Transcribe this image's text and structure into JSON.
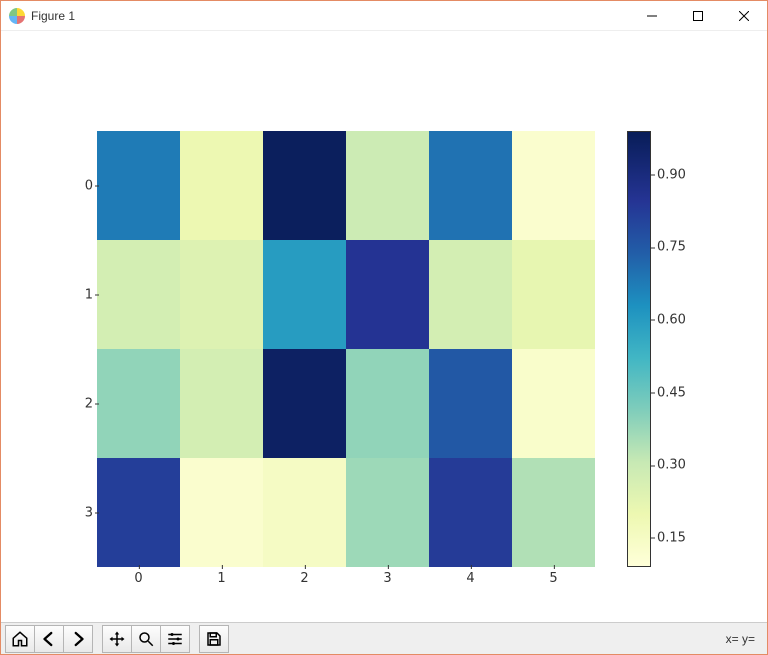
{
  "window": {
    "title": "Figure 1"
  },
  "toolbar": {
    "coord_label": "x= y="
  },
  "chart_data": {
    "type": "heatmap",
    "x_categories": [
      "0",
      "1",
      "2",
      "3",
      "4",
      "5"
    ],
    "y_categories": [
      "0",
      "1",
      "2",
      "3"
    ],
    "colorbar_ticks": [
      0.15,
      0.3,
      0.45,
      0.6,
      0.75,
      0.9
    ],
    "vmin": 0.09,
    "vmax": 0.99,
    "cmap": "YlGnBu",
    "values": [
      [
        0.7,
        0.2,
        0.98,
        0.3,
        0.72,
        0.12
      ],
      [
        0.28,
        0.25,
        0.62,
        0.88,
        0.28,
        0.22
      ],
      [
        0.4,
        0.28,
        0.97,
        0.4,
        0.78,
        0.13
      ],
      [
        0.85,
        0.12,
        0.15,
        0.38,
        0.86,
        0.35
      ]
    ]
  }
}
